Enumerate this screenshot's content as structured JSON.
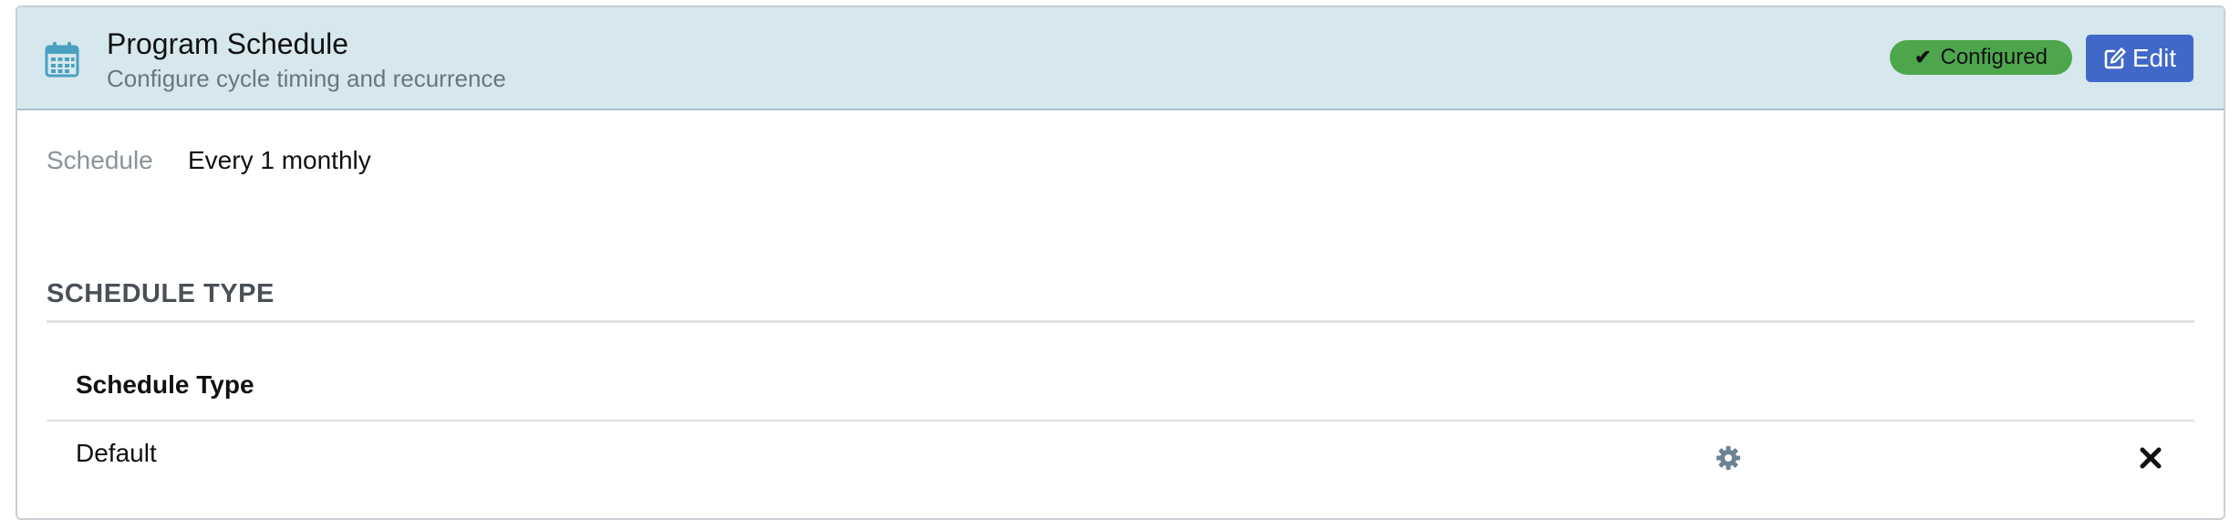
{
  "header": {
    "icon": "calendar-icon",
    "title": "Program Schedule",
    "subtitle": "Configure cycle timing and recurrence",
    "status_badge": "Configured",
    "status_icon": "check-icon",
    "status_color": "#4ea64c",
    "edit_label": "Edit",
    "edit_icon": "edit-icon",
    "edit_color": "#3f68c8",
    "background_color": "#d6e8ee"
  },
  "summary": {
    "label": "Schedule",
    "value": "Every 1 monthly"
  },
  "section": {
    "heading": "SCHEDULE TYPE",
    "column_header": "Schedule Type",
    "rows": [
      {
        "name": "Default",
        "settings_icon": "gear-icon",
        "remove_icon": "close-icon"
      }
    ]
  }
}
